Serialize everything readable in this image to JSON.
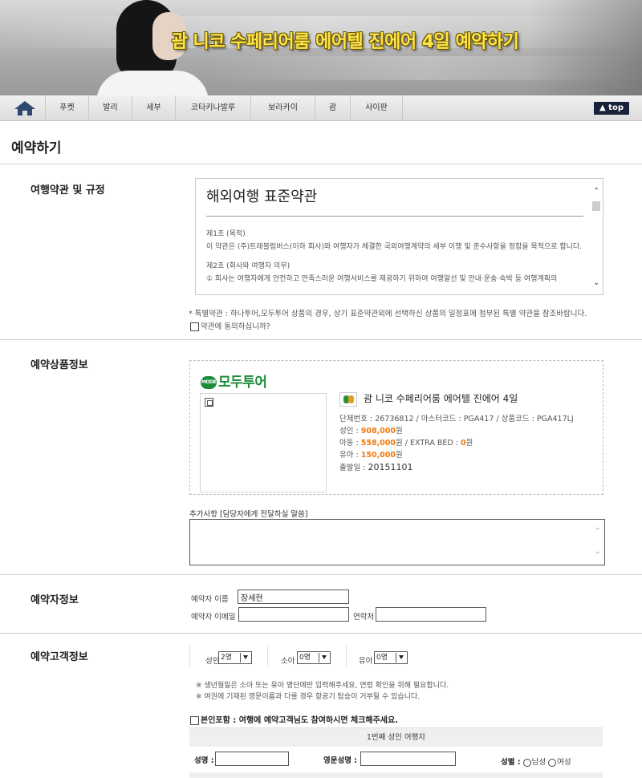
{
  "banner": {
    "title": "괌 니코 수페리어룸 에어텔 진에어 4일 예약하기"
  },
  "nav": {
    "home_icon": "home-icon",
    "items": [
      "푸켓",
      "발리",
      "세부",
      "코타키나발루",
      "보라카이",
      "괌",
      "사이판"
    ],
    "top_label": "▲ top"
  },
  "page": {
    "title": "예약하기"
  },
  "terms": {
    "section_label": "여행약관 및 규정",
    "heading": "해외여행 표준약관",
    "article1_title": "제1조 (목적)",
    "article1_text": "이 약관은 (주)트래블럼버스(이하 회사)와 여행자가 체결한 국외여행계약의 세부 이행 및 준수사항을 정함을 목적으로 합니다.",
    "article2_title": "제2조 (회사와 여행자 의무)",
    "article2_text": "① 회사는 여행자에게 안전하고 만족스러운 여행서비스를 제공하기 위하여 여행알선 및 안내·운송·숙박 등 여행계획의",
    "special_note": "* 특별약관 : 하나투어,모두투어 상품의 경우, 상기 표준약관외에 선택하신 상품의 일정표에 첨부된 특별 약관을 참조바랍니다.",
    "agree_label": "약관에 동의하십니까?"
  },
  "product": {
    "section_label": "예약상품정보",
    "brand": "모두투어",
    "brand_badge": "MODE",
    "title": "괌 니코 수페리어룸 에어텔 진에어 4일",
    "codes": "단체번호 : 26736812 / 마스터코드 : PGA417 / 상품코드 : PGA417LJ",
    "adult_label": "성인 : ",
    "adult_price": "908,000",
    "child_label": "아동 : ",
    "child_price": "558,000",
    "extra_bed_label": "원 / EXTRA BED : ",
    "extra_bed_price": "0",
    "infant_label": "유아 : ",
    "infant_price": "150,000",
    "won": "원",
    "depart_label": "출발일 : ",
    "depart_date": "20151101",
    "request_label": "추가사항 [담당자에게 전달하실 말씀]"
  },
  "booker": {
    "section_label": "예약자정보",
    "name_label": "예약자 이름",
    "name_value": "장세현",
    "email_label": "예약자 이메일",
    "email_value": "",
    "phone_label": "연락처",
    "phone_value": ""
  },
  "customers": {
    "section_label": "예약고객정보",
    "adult_label": "성인",
    "adult_value": "2명",
    "child_label": "소아",
    "child_value": "0명",
    "infant_label": "유아",
    "infant_value": "0명",
    "warn1": "※ 생년월일은 소아 또는 유아 명단에만 입력해주세요, 연령 확인을 위해 필요합니다.",
    "warn2": "※ 여권에 기재된 영문이름과 다를 경우 항공기 탑승이 거부될 수 있습니다.",
    "self_include_label": "본인포함 : 여행에 예약고객님도 참여하시면 체크해주세요.",
    "traveler_header": "1번째 성인 여행자",
    "name_label": "성명 :",
    "eng_name_label": "영문성명 :",
    "gender_label": "성별 :",
    "male_label": "남성",
    "female_label": "여성"
  }
}
